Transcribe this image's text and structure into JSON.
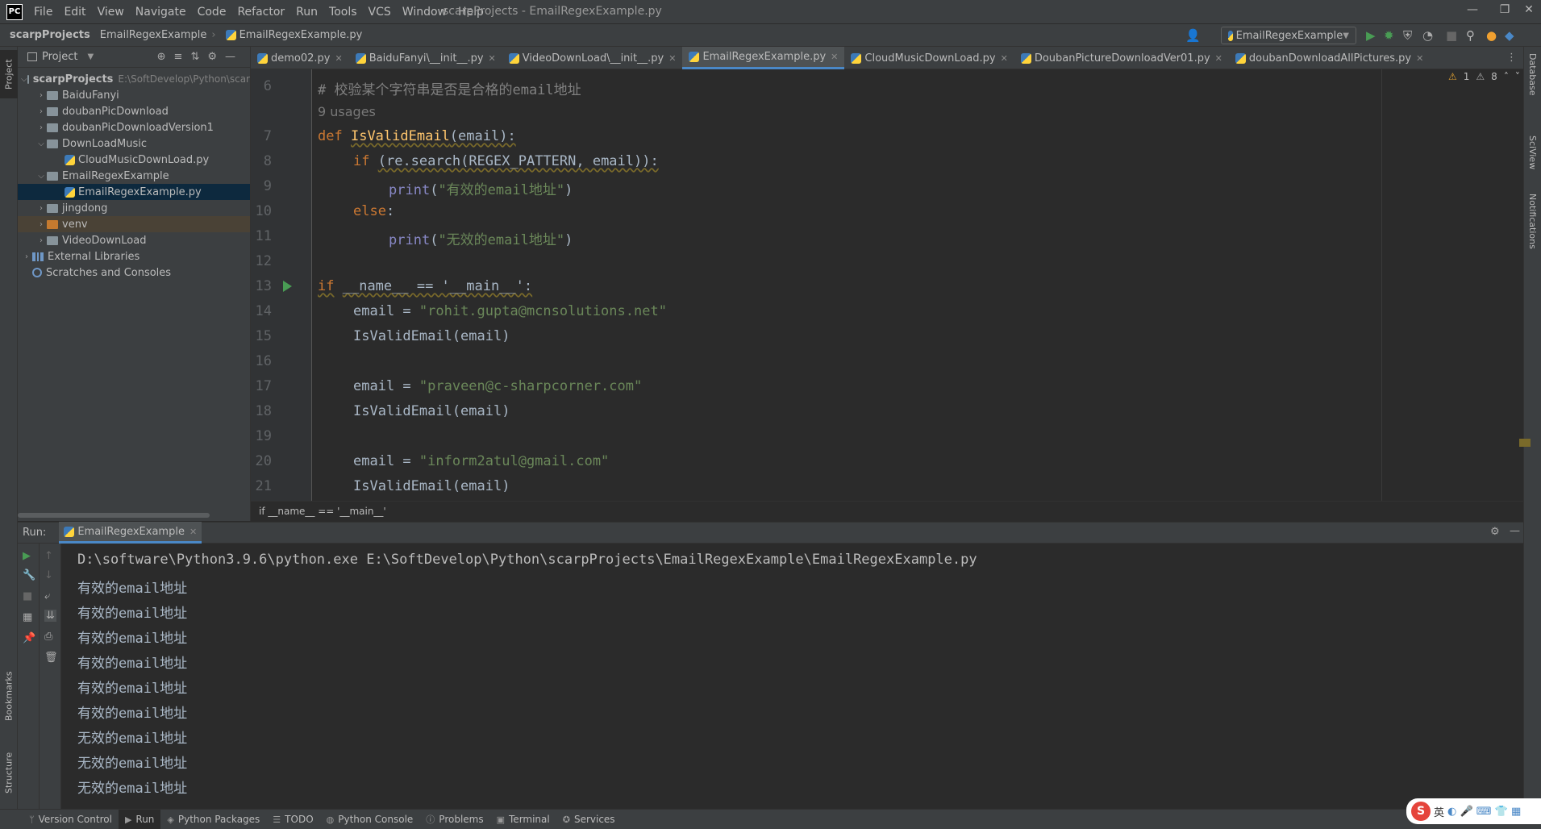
{
  "app": {
    "logo_text": "PC",
    "window_title": "scarpProjects - EmailRegexExample.py",
    "menu": [
      "File",
      "Edit",
      "View",
      "Navigate",
      "Code",
      "Refactor",
      "Run",
      "Tools",
      "VCS",
      "Window",
      "Help"
    ]
  },
  "navbar": {
    "crumbs": [
      "scarpProjects",
      "EmailRegexExample",
      "EmailRegexExample.py"
    ],
    "run_config": "EmailRegexExample"
  },
  "project": {
    "header": "Project",
    "root_name": "scarpProjects",
    "root_path": "E:\\SoftDevelop\\Python\\scar",
    "items": [
      {
        "label": "BaiduFanyi"
      },
      {
        "label": "doubanPicDownload"
      },
      {
        "label": "doubanPicDownloadVersion1"
      },
      {
        "label": "DownLoadMusic"
      },
      {
        "label": "CloudMusicDownLoad.py"
      },
      {
        "label": "EmailRegexExample"
      },
      {
        "label": "EmailRegexExample.py"
      },
      {
        "label": "jingdong"
      },
      {
        "label": "venv"
      },
      {
        "label": "VideoDownLoad"
      },
      {
        "label": "External Libraries"
      },
      {
        "label": "Scratches and Consoles"
      }
    ]
  },
  "tabs": [
    "demo02.py",
    "BaiduFanyi\\__init__.py",
    "VideoDownLoad\\__init__.py",
    "EmailRegexExample.py",
    "CloudMusicDownLoad.py",
    "DoubanPictureDownloadVer01.py",
    "doubanDownloadAllPictures.py"
  ],
  "inspections": {
    "warnings": "1",
    "weak_warnings": "8"
  },
  "editor": {
    "line_numbers": [
      "6",
      "7",
      "8",
      "9",
      "10",
      "11",
      "12",
      "13",
      "14",
      "15",
      "16",
      "17",
      "18",
      "19",
      "20",
      "21"
    ],
    "comment": "# 校验某个字符串是否是合格的email地址",
    "usages": "9 usages",
    "def_kw": "def",
    "def_name": "IsValidEmail",
    "def_args": "(email):",
    "if_kw": "if",
    "if_cond": "(re.search(REGEX_PATTERN, email)):",
    "print_fn": "print",
    "print_valid": "\"有效的email地址\"",
    "else_kw": "else",
    "print_invalid": "\"无效的email地址\"",
    "main_if": "if",
    "main_cond": "__name__ == '__main__':",
    "email_assign": "email = ",
    "email1": "\"rohit.gupta@mcnsolutions.net\"",
    "email2": "\"praveen@c-sharpcorner.com\"",
    "email3": "\"inform2atul@gmail.com\"",
    "call": "IsValidEmail(email)"
  },
  "code_breadcrumb": "if __name__ == '__main__'",
  "run": {
    "label": "Run:",
    "tab": "EmailRegexExample",
    "command": "D:\\software\\Python3.9.6\\python.exe E:\\SoftDevelop\\Python\\scarpProjects\\EmailRegexExample\\EmailRegexExample.py",
    "output": [
      "有效的email地址",
      "有效的email地址",
      "有效的email地址",
      "有效的email地址",
      "有效的email地址",
      "有效的email地址",
      "无效的email地址",
      "无效的email地址",
      "无效的email地址"
    ]
  },
  "side_tabs": {
    "project": "Project",
    "bookmarks": "Bookmarks",
    "structure": "Structure",
    "database": "Database",
    "sciview": "SciView",
    "notifications": "Notifications"
  },
  "bottom_tools": [
    "Version Control",
    "Run",
    "Python Packages",
    "TODO",
    "Python Console",
    "Problems",
    "Terminal",
    "Services"
  ],
  "ime": {
    "logo": "S",
    "text": "英"
  },
  "colors": {
    "accent": "#4a88c7",
    "keyword": "#cc7832",
    "function": "#ffc66d",
    "string": "#6a8759",
    "run_green": "#499c54"
  }
}
